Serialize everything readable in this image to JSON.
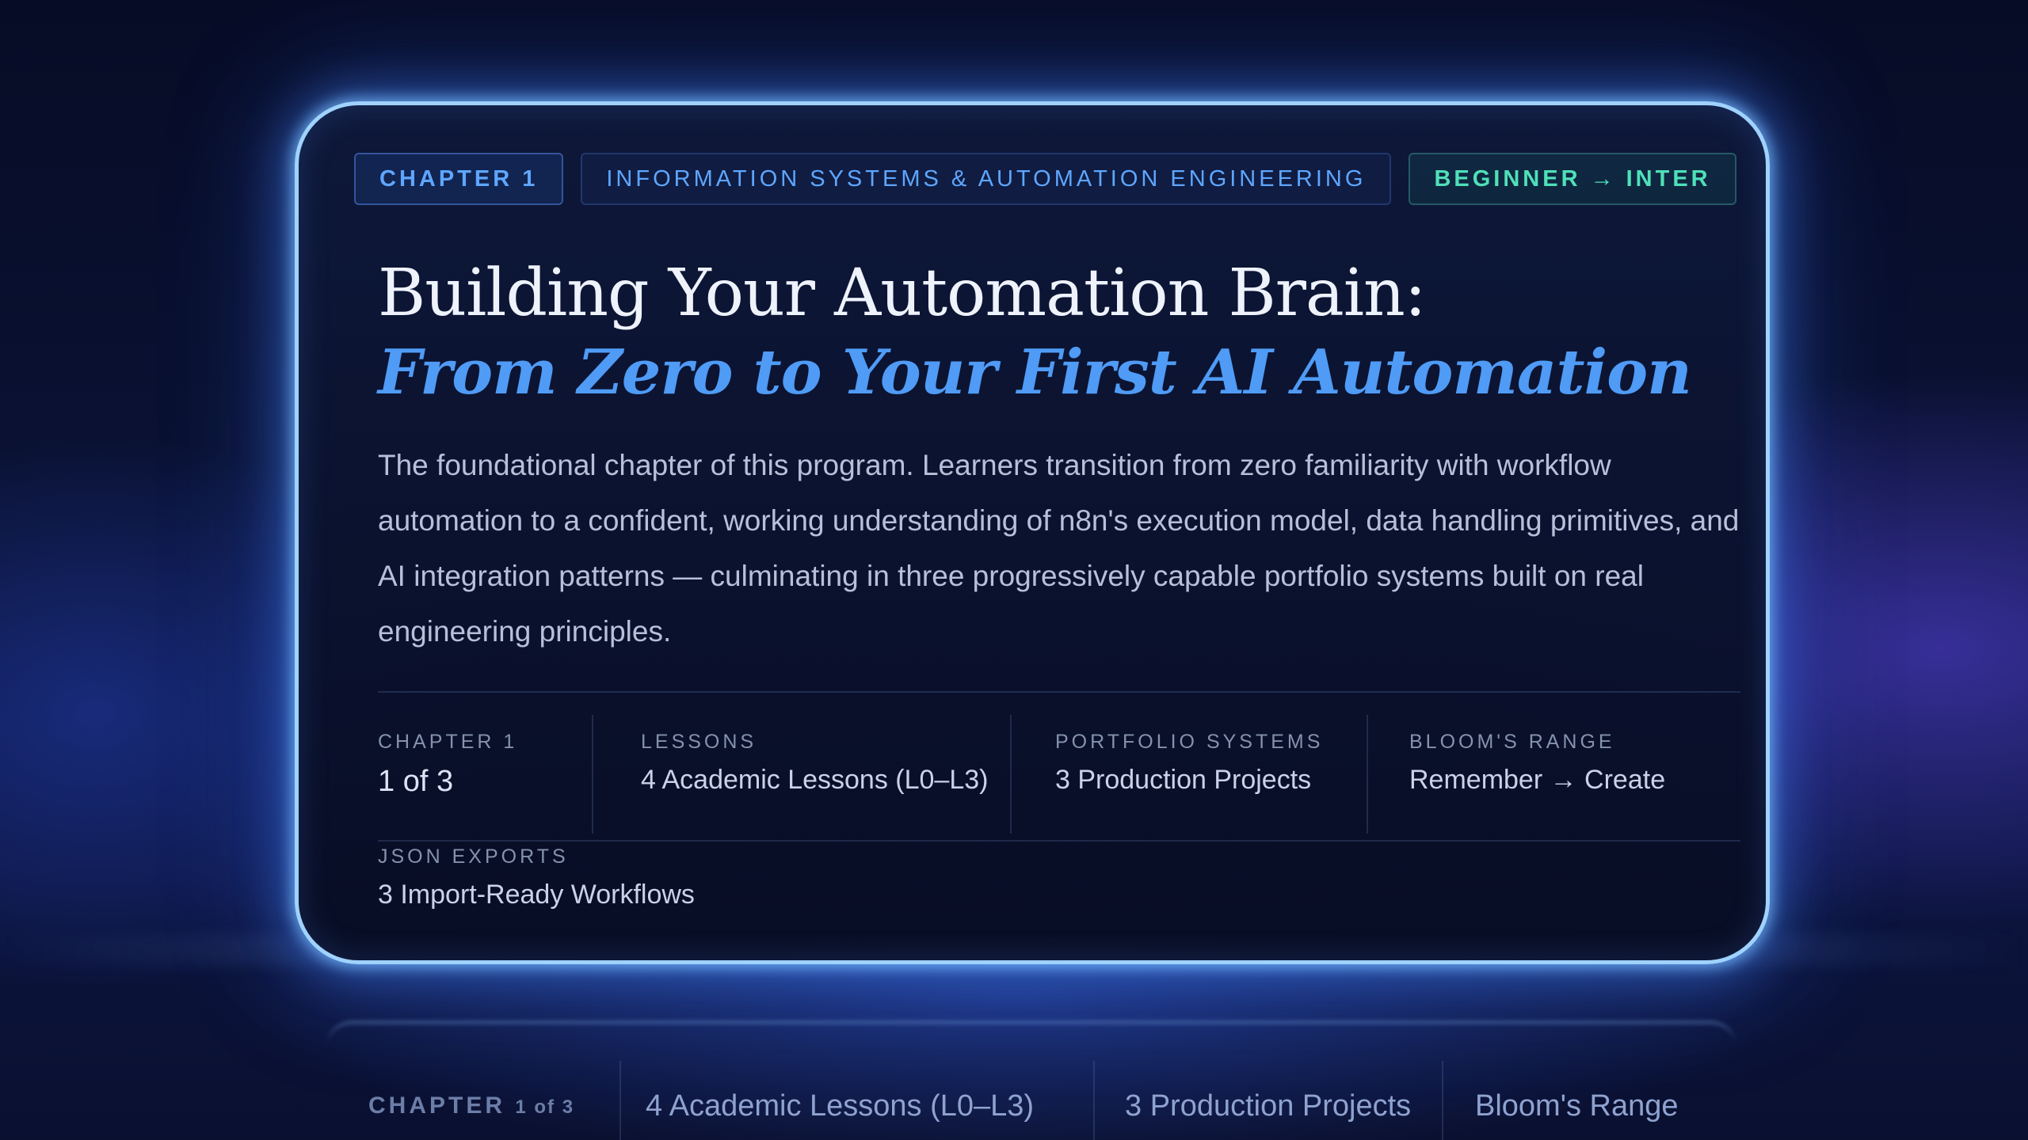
{
  "tags": {
    "chapter": "CHAPTER 1",
    "domain": "INFORMATION SYSTEMS & AUTOMATION ENGINEERING",
    "level": "BEGINNER → INTER"
  },
  "title": "Building Your Automation Brain:",
  "subtitle": "From Zero to Your First AI Automation",
  "description": "The foundational chapter of this program. Learners transition from zero familiarity with workflow automation to a confident, working understanding of n8n's execution model, data handling primitives, and AI integration patterns — culminating in three progressively capable portfolio systems built on real engineering principles.",
  "stats": [
    {
      "label": "CHAPTER 1",
      "value": "1 of 3"
    },
    {
      "label": "LESSONS",
      "value": "4 Academic Lessons (L0–L3)"
    },
    {
      "label": "PORTFOLIO SYSTEMS",
      "value": "3 Production Projects"
    },
    {
      "label": "BLOOM'S RANGE",
      "value": "Remember → Create"
    },
    {
      "label": "JSON EXPORTS",
      "value": "3 Import-Ready Workflows"
    }
  ],
  "reflection": {
    "chapter": "CHAPTER",
    "chapter_num": "1 of 3",
    "lessons": "4 Academic Lessons (L0–L3)",
    "projects": "3 Production Projects",
    "bloom": "Bloom's Range"
  },
  "colors": {
    "accent_blue": "#4f9bf6",
    "accent_teal": "#4fe0b8",
    "card_border": "#9fd2ff"
  }
}
